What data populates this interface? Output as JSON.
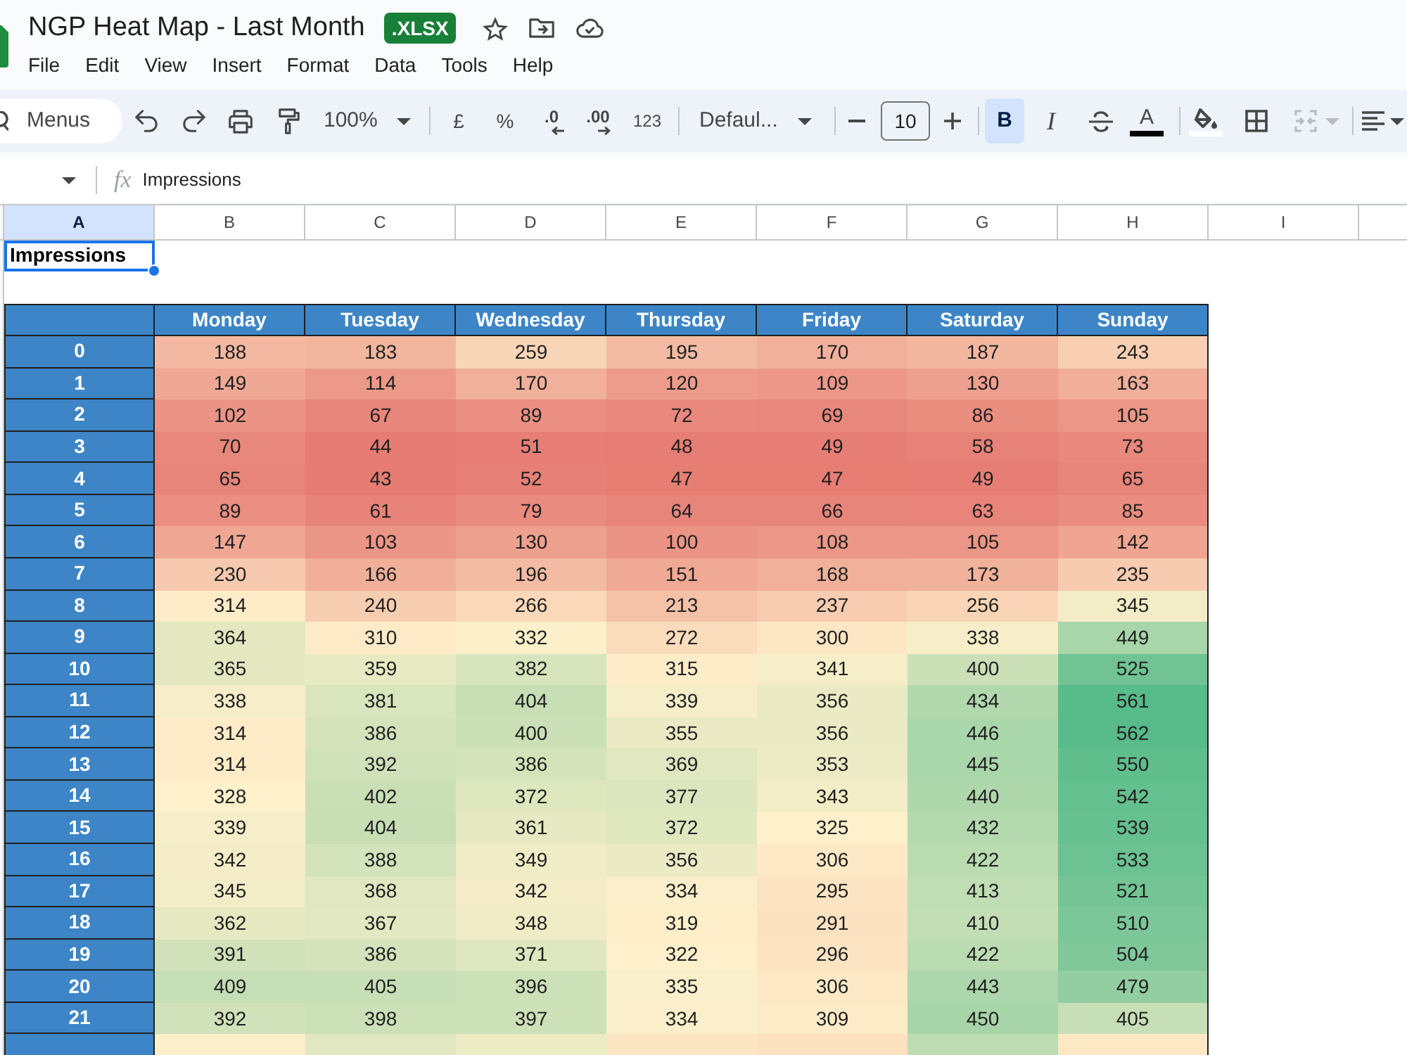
{
  "title_bar": {
    "title": "NGP Heat Map - Last Month",
    "badge": ".XLSX"
  },
  "menu": [
    "File",
    "Edit",
    "View",
    "Insert",
    "Format",
    "Data",
    "Tools",
    "Help"
  ],
  "toolbar": {
    "search_placeholder": "Menus",
    "zoom": "100%",
    "currency": "£",
    "percent": "%",
    "decrease_decimal": ".0",
    "increase_decimal": ".00",
    "number_format": "123",
    "font": "Defaul...",
    "font_size": "10",
    "bold": {
      "label": "B",
      "on": true
    },
    "italic": {
      "label": "I",
      "on": false
    },
    "text_color": {
      "label": "A"
    },
    "merge": {
      "disabled": true
    }
  },
  "formula_bar": {
    "function_label": "fx",
    "value": "Impressions"
  },
  "sheet": {
    "column_headers": [
      {
        "label": "A",
        "selected": true
      },
      {
        "label": "B",
        "selected": false
      },
      {
        "label": "C",
        "selected": false
      },
      {
        "label": "D",
        "selected": false
      },
      {
        "label": "E",
        "selected": false
      },
      {
        "label": "F",
        "selected": false
      },
      {
        "label": "G",
        "selected": false
      },
      {
        "label": "H",
        "selected": false
      },
      {
        "label": "I",
        "selected": false
      }
    ],
    "selected_cell": {
      "text": "Impressions",
      "selected": true
    },
    "heatmap": {
      "columns": [
        "Monday",
        "Tuesday",
        "Wednesday",
        "Thursday",
        "Friday",
        "Saturday",
        "Sunday"
      ],
      "rows": [
        {
          "label": "0",
          "values": [
            "188",
            "183",
            "259",
            "195",
            "170",
            "187",
            "243"
          ]
        },
        {
          "label": "1",
          "values": [
            "149",
            "114",
            "170",
            "120",
            "109",
            "130",
            "163"
          ]
        },
        {
          "label": "2",
          "values": [
            "102",
            "67",
            "89",
            "72",
            "69",
            "86",
            "105"
          ]
        },
        {
          "label": "3",
          "values": [
            "70",
            "44",
            "51",
            "48",
            "49",
            "58",
            "73"
          ]
        },
        {
          "label": "4",
          "values": [
            "65",
            "43",
            "52",
            "47",
            "47",
            "49",
            "65"
          ]
        },
        {
          "label": "5",
          "values": [
            "89",
            "61",
            "79",
            "64",
            "66",
            "63",
            "85"
          ]
        },
        {
          "label": "6",
          "values": [
            "147",
            "103",
            "130",
            "100",
            "108",
            "105",
            "142"
          ]
        },
        {
          "label": "7",
          "values": [
            "230",
            "166",
            "196",
            "151",
            "168",
            "173",
            "235"
          ]
        },
        {
          "label": "8",
          "values": [
            "314",
            "240",
            "266",
            "213",
            "237",
            "256",
            "345"
          ]
        },
        {
          "label": "9",
          "values": [
            "364",
            "310",
            "332",
            "272",
            "300",
            "338",
            "449"
          ]
        },
        {
          "label": "10",
          "values": [
            "365",
            "359",
            "382",
            "315",
            "341",
            "400",
            "525"
          ]
        },
        {
          "label": "11",
          "values": [
            "338",
            "381",
            "404",
            "339",
            "356",
            "434",
            "561"
          ]
        },
        {
          "label": "12",
          "values": [
            "314",
            "386",
            "400",
            "355",
            "356",
            "446",
            "562"
          ]
        },
        {
          "label": "13",
          "values": [
            "314",
            "392",
            "386",
            "369",
            "353",
            "445",
            "550"
          ]
        },
        {
          "label": "14",
          "values": [
            "328",
            "402",
            "372",
            "377",
            "343",
            "440",
            "542"
          ]
        },
        {
          "label": "15",
          "values": [
            "339",
            "404",
            "361",
            "372",
            "325",
            "432",
            "539"
          ]
        },
        {
          "label": "16",
          "values": [
            "342",
            "388",
            "349",
            "356",
            "306",
            "422",
            "533"
          ]
        },
        {
          "label": "17",
          "values": [
            "345",
            "368",
            "342",
            "334",
            "295",
            "413",
            "521"
          ]
        },
        {
          "label": "18",
          "values": [
            "362",
            "367",
            "348",
            "319",
            "291",
            "410",
            "510"
          ]
        },
        {
          "label": "19",
          "values": [
            "391",
            "386",
            "371",
            "322",
            "296",
            "422",
            "504"
          ]
        },
        {
          "label": "20",
          "values": [
            "409",
            "405",
            "396",
            "335",
            "306",
            "443",
            "479"
          ]
        },
        {
          "label": "21",
          "values": [
            "392",
            "398",
            "397",
            "334",
            "309",
            "450",
            "405"
          ]
        }
      ],
      "cut_off_row": {
        "cells": [
          {
            "color": "#fbf0cb"
          },
          {
            "color": "#e1e7c0"
          },
          {
            "color": "#ebebc4"
          },
          {
            "color": "#fce5c3"
          },
          {
            "color": "#fce1c0"
          },
          {
            "color": "#bedcb2"
          },
          {
            "color": "#fde8c5"
          }
        ]
      }
    }
  }
}
